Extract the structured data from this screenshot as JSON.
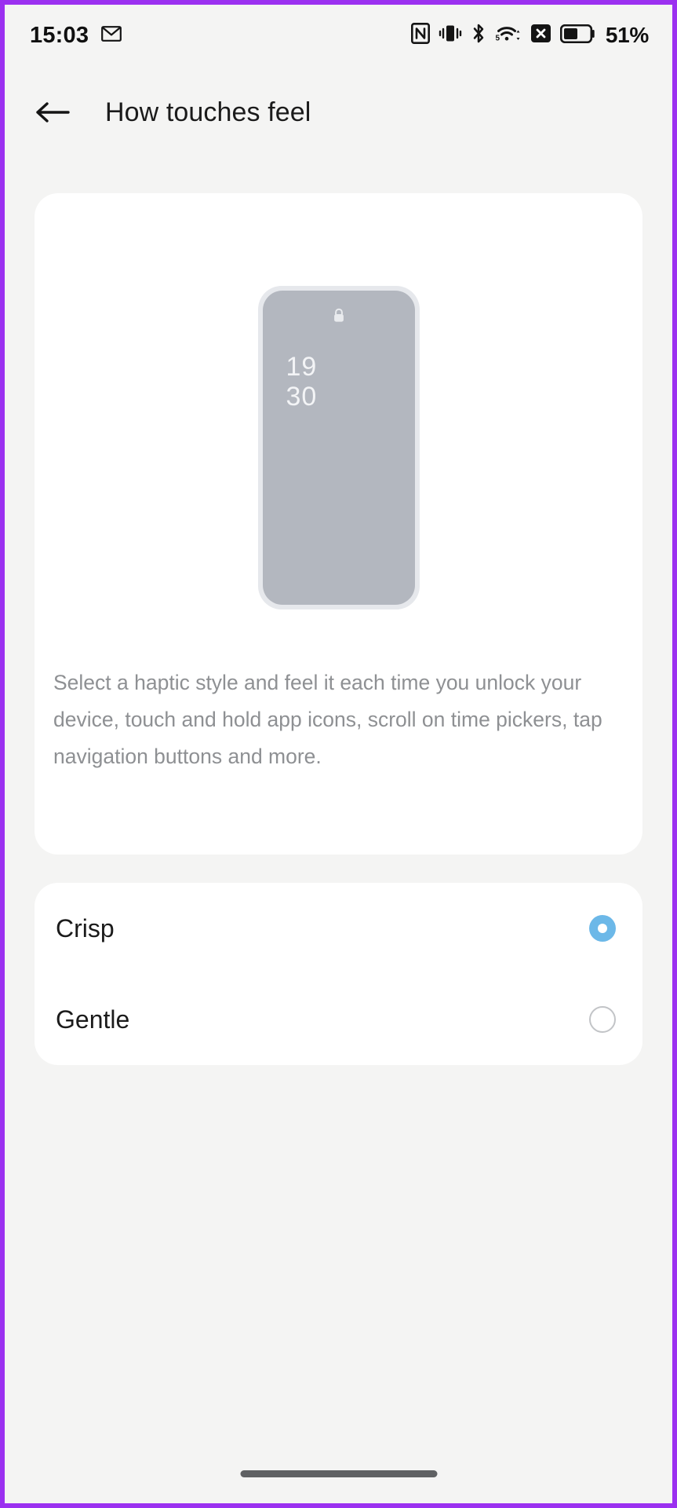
{
  "status_bar": {
    "clock": "15:03",
    "left_icons": [
      {
        "name": "gmail-icon",
        "label": "M"
      }
    ],
    "right_icons": [
      {
        "name": "nfc-icon",
        "label": "NFC"
      },
      {
        "name": "vibrate-icon",
        "label": "Vibrate"
      },
      {
        "name": "bluetooth-icon",
        "label": "Bluetooth"
      },
      {
        "name": "wifi-icon",
        "label": "Wi-Fi 5"
      },
      {
        "name": "no-sim-icon",
        "label": "No SIM"
      }
    ],
    "battery_percent": "51%",
    "battery_level": 51
  },
  "app_bar": {
    "back_label": "Back",
    "title": "How touches feel"
  },
  "preview": {
    "lock_icon": "lock-icon",
    "mock_time_hours": "19",
    "mock_time_minutes": "30",
    "description": "Select a haptic style and feel it each time you unlock your device, touch and hold app icons, scroll on time pickers, tap navigation buttons and more."
  },
  "options": {
    "selected": "Crisp",
    "items": [
      {
        "label": "Crisp",
        "checked": true
      },
      {
        "label": "Gentle",
        "checked": false
      }
    ]
  },
  "nav": {
    "handle_label": "Home gesture handle"
  },
  "colors": {
    "accent": "#6cb8e8",
    "background": "#f4f4f3",
    "card": "#ffffff",
    "frame": "#9b30f0",
    "phone_body": "#b3b7bf",
    "text_primary": "#1b1b1b",
    "text_secondary": "#8e9093"
  }
}
